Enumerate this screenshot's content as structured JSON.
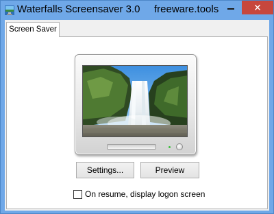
{
  "window": {
    "title": "Waterfalls Screensaver 3.0",
    "site": "freeware.tools",
    "close_glyph": "✕",
    "accent_color": "#6fa8e8",
    "close_color": "#c7473d"
  },
  "tabs": [
    {
      "label": "Screen Saver",
      "selected": true
    }
  ],
  "preview": {
    "image": "waterfall-scene",
    "icon": "monitor-preview"
  },
  "buttons": {
    "settings": "Settings...",
    "preview": "Preview"
  },
  "options": {
    "logon_label": "On resume, display logon screen",
    "logon_checked": false
  }
}
